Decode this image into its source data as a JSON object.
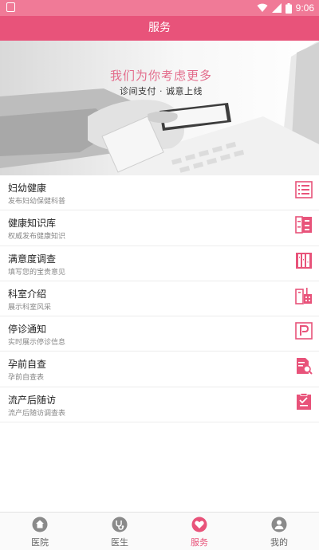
{
  "status_bar": {
    "time": "9:06"
  },
  "app_bar": {
    "title": "服务"
  },
  "banner": {
    "headline": "我们为你考虑更多",
    "subline": "诊间支付 · 诚意上线"
  },
  "services": [
    {
      "title": "妇幼健康",
      "subtitle": "发布妇幼保健科普",
      "icon": "list-icon"
    },
    {
      "title": "健康知识库",
      "subtitle": "权威发布健康知识",
      "icon": "cabinet-icon"
    },
    {
      "title": "满意度调查",
      "subtitle": "填写您的宝贵意见",
      "icon": "survey-icon"
    },
    {
      "title": "科室介绍",
      "subtitle": "展示科室风采",
      "icon": "building-icon"
    },
    {
      "title": "停诊通知",
      "subtitle": "实时展示停诊信息",
      "icon": "parking-notice-icon"
    },
    {
      "title": "孕前自查",
      "subtitle": "孕前自查表",
      "icon": "document-search-icon"
    },
    {
      "title": "流产后随访",
      "subtitle": "流产后随访调查表",
      "icon": "checklist-icon"
    }
  ],
  "tabs": [
    {
      "label": "医院",
      "icon": "home-icon",
      "active": false
    },
    {
      "label": "医生",
      "icon": "stethoscope-icon",
      "active": false
    },
    {
      "label": "服务",
      "icon": "heart-icon",
      "active": true
    },
    {
      "label": "我的",
      "icon": "user-icon",
      "active": false
    }
  ],
  "colors": {
    "primary": "#e8537a",
    "status_bar": "#f07a97",
    "icon_pink": "#e8537a"
  }
}
